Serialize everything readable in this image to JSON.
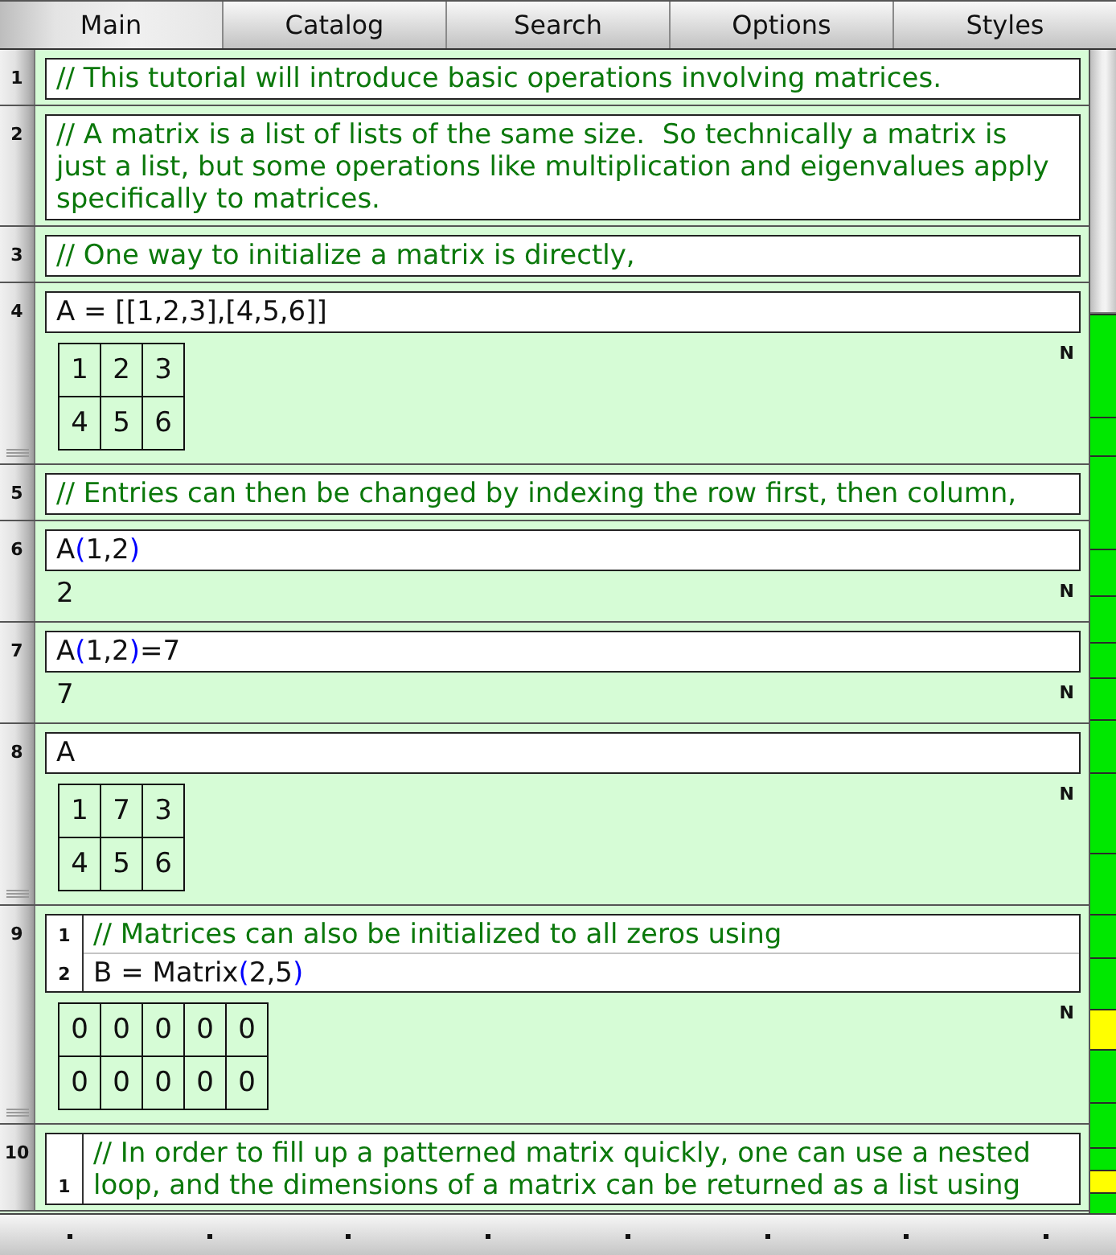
{
  "tabs": [
    {
      "label": "Main",
      "selected": true
    },
    {
      "label": "Catalog",
      "selected": false
    },
    {
      "label": "Search",
      "selected": false
    },
    {
      "label": "Options",
      "selected": false
    },
    {
      "label": "Styles",
      "selected": false
    }
  ],
  "cells": [
    {
      "number": "1",
      "input": {
        "lines": [
          {
            "kind": "comment",
            "text": "// This tutorial will introduce basic operations involving matrices."
          }
        ]
      }
    },
    {
      "number": "2",
      "input": {
        "lines": [
          {
            "kind": "comment",
            "text": "// A matrix is a list of lists of the same size.  So technically a matrix is just a list, but some operations like multiplication and eigenvalues apply specifically to matrices."
          }
        ]
      }
    },
    {
      "number": "3",
      "input": {
        "lines": [
          {
            "kind": "comment",
            "text": "// One way to initialize a matrix is directly,"
          }
        ]
      }
    },
    {
      "number": "4",
      "input": {
        "lines": [
          {
            "kind": "code",
            "tokens": [
              {
                "kind": "plain",
                "text": "A = [[1,2,3],[4,5,6]]"
              }
            ]
          }
        ]
      },
      "output": {
        "kind": "matrix",
        "rows": [
          [
            "1",
            "2",
            "3"
          ],
          [
            "4",
            "5",
            "6"
          ]
        ],
        "mode": "N"
      }
    },
    {
      "number": "5",
      "input": {
        "lines": [
          {
            "kind": "comment",
            "text": "// Entries can then be changed by indexing the row first, then column,"
          }
        ]
      }
    },
    {
      "number": "6",
      "input": {
        "lines": [
          {
            "kind": "code",
            "tokens": [
              {
                "kind": "plain",
                "text": "A"
              },
              {
                "kind": "paren",
                "text": "("
              },
              {
                "kind": "plain",
                "text": "1,2"
              },
              {
                "kind": "paren",
                "text": ")"
              }
            ]
          }
        ]
      },
      "output": {
        "kind": "value",
        "text": "2",
        "mode": "N"
      }
    },
    {
      "number": "7",
      "input": {
        "lines": [
          {
            "kind": "code",
            "tokens": [
              {
                "kind": "plain",
                "text": "A"
              },
              {
                "kind": "paren",
                "text": "("
              },
              {
                "kind": "plain",
                "text": "1,2"
              },
              {
                "kind": "paren",
                "text": ")"
              },
              {
                "kind": "plain",
                "text": "=7"
              }
            ]
          }
        ]
      },
      "output": {
        "kind": "value",
        "text": "7",
        "mode": "N"
      }
    },
    {
      "number": "8",
      "input": {
        "lines": [
          {
            "kind": "code",
            "tokens": [
              {
                "kind": "plain",
                "text": "A"
              }
            ]
          }
        ]
      },
      "output": {
        "kind": "matrix",
        "rows": [
          [
            "1",
            "7",
            "3"
          ],
          [
            "4",
            "5",
            "6"
          ]
        ],
        "mode": "N"
      }
    },
    {
      "number": "9",
      "input": {
        "lines": [
          {
            "number": "1",
            "kind": "comment",
            "text": "// Matrices can also be initialized to all zeros using"
          },
          {
            "number": "2",
            "kind": "code",
            "tokens": [
              {
                "kind": "plain",
                "text": "B = Matrix"
              },
              {
                "kind": "paren",
                "text": "("
              },
              {
                "kind": "plain",
                "text": "2,5"
              },
              {
                "kind": "paren",
                "text": ")"
              }
            ]
          }
        ]
      },
      "output": {
        "kind": "matrix",
        "rows": [
          [
            "0",
            "0",
            "0",
            "0",
            "0"
          ],
          [
            "0",
            "0",
            "0",
            "0",
            "0"
          ]
        ],
        "mode": "N"
      }
    },
    {
      "number": "10",
      "input": {
        "lines": [
          {
            "number": "1",
            "kind": "comment",
            "text": "// In order to fill up a patterned matrix quickly, one can use a nested loop, and the dimensions of a matrix can be returned as a list using"
          }
        ]
      }
    }
  ],
  "scrollbar": {
    "markers": [
      {
        "color": "#00e800"
      },
      {
        "color": "#00e800"
      },
      {
        "color": "#00e800"
      },
      {
        "color": "#00e800"
      },
      {
        "color": "#00e800"
      },
      {
        "color": "#00e800"
      },
      {
        "color": "#00e800"
      },
      {
        "color": "#00e800"
      },
      {
        "color": "#00e800"
      },
      {
        "color": "#00e800"
      },
      {
        "color": "#00e800"
      },
      {
        "color": "#00e800"
      },
      {
        "color": "#ffff00"
      },
      {
        "color": "#00e800"
      },
      {
        "color": "#00e800"
      },
      {
        "color": "#00e800"
      },
      {
        "color": "#ffff00"
      },
      {
        "color": "#00e800"
      }
    ]
  }
}
